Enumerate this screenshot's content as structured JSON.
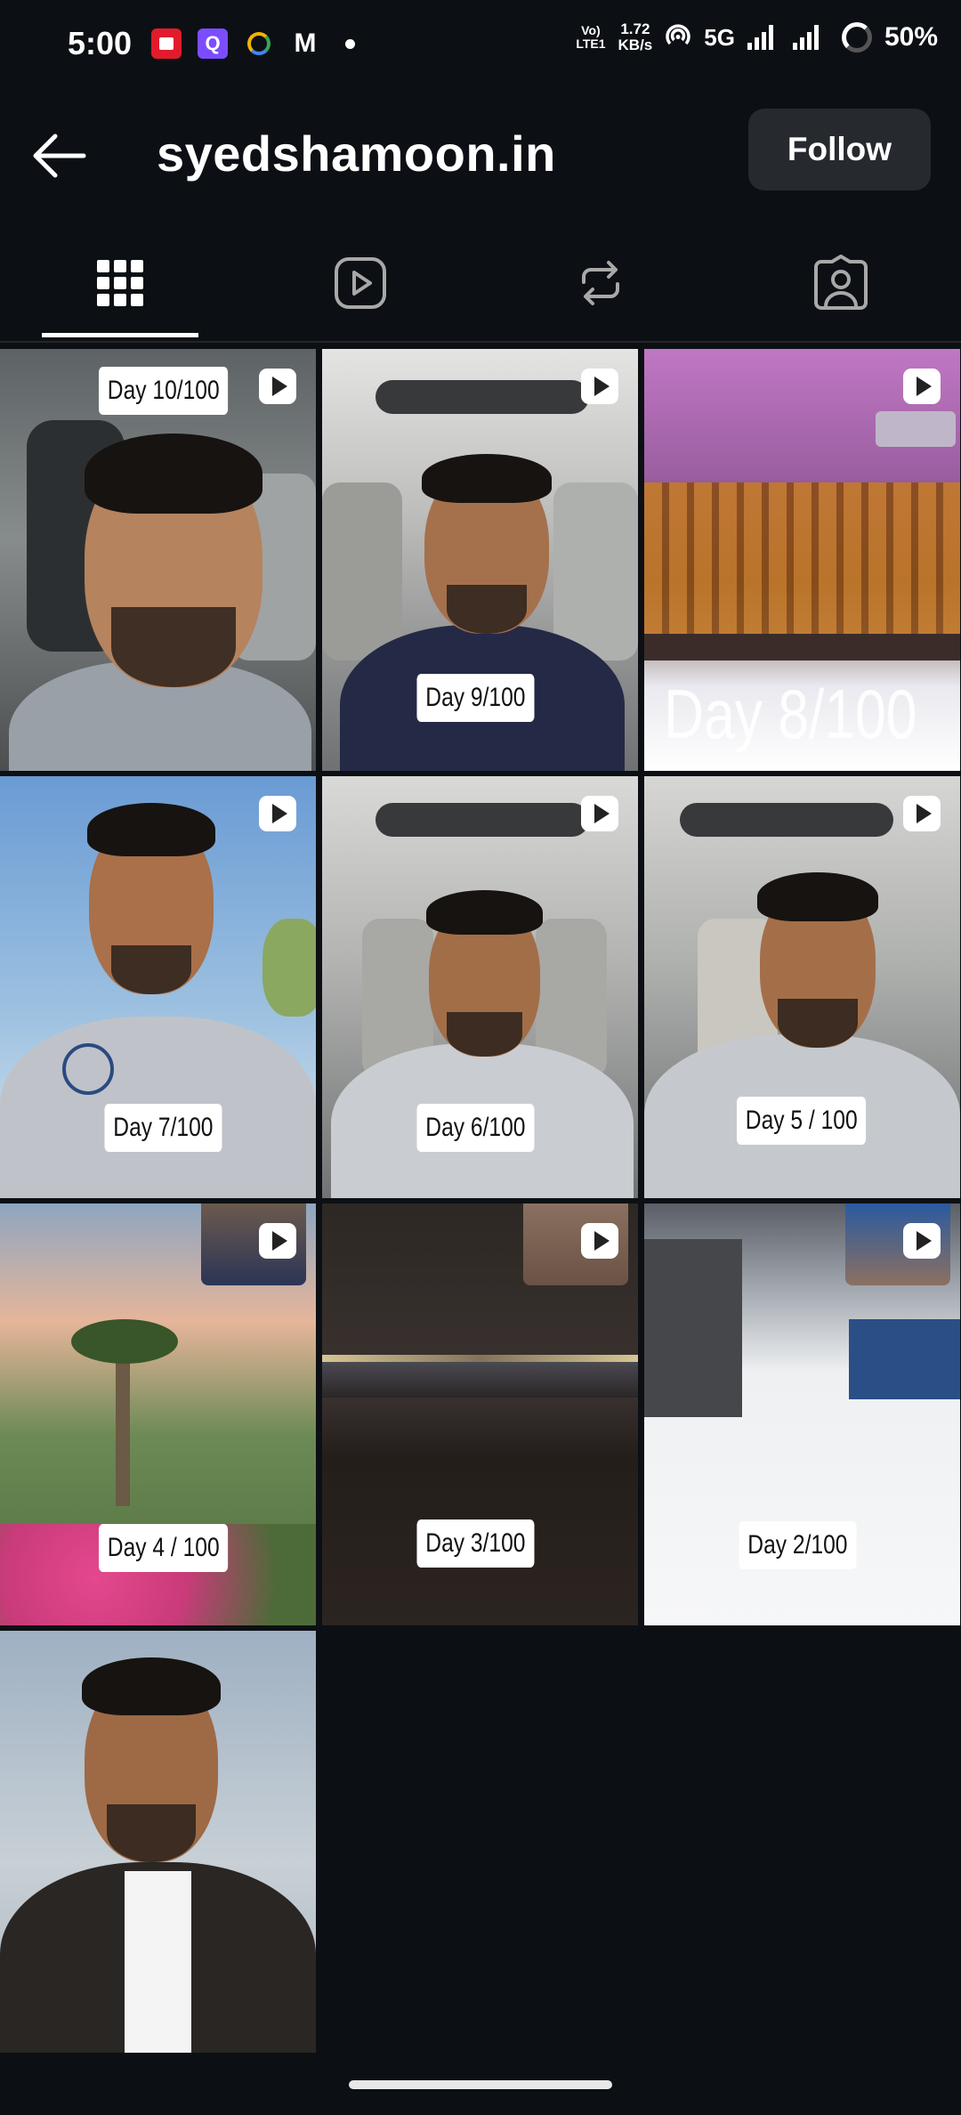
{
  "status": {
    "time": "5:00",
    "volte_top": "Vo)",
    "volte_bottom": "LTE1",
    "speed_top": "1.72",
    "speed_bottom": "KB/s",
    "network": "5G",
    "battery": "50%"
  },
  "header": {
    "title": "syedshamoon.in",
    "follow_label": "Follow"
  },
  "tabs": [
    "grid",
    "reels",
    "reposts",
    "tagged"
  ],
  "posts": [
    {
      "label": "Day 10/100",
      "type": "reel"
    },
    {
      "label": "Day 9/100",
      "type": "reel"
    },
    {
      "label": "Day 8/100",
      "type": "reel"
    },
    {
      "label": "Day 7/100",
      "type": "reel"
    },
    {
      "label": "Day 6/100",
      "type": "reel"
    },
    {
      "label": "Day 5 / 100",
      "type": "reel"
    },
    {
      "label": "Day 4 / 100",
      "type": "reel"
    },
    {
      "label": "Day 3/100",
      "type": "reel"
    },
    {
      "label": "Day 2/100",
      "type": "reel"
    },
    {
      "label": "",
      "type": "photo"
    }
  ],
  "colors": {
    "background": "#0c1014",
    "button": "#262a2e",
    "text": "#ffffff"
  }
}
